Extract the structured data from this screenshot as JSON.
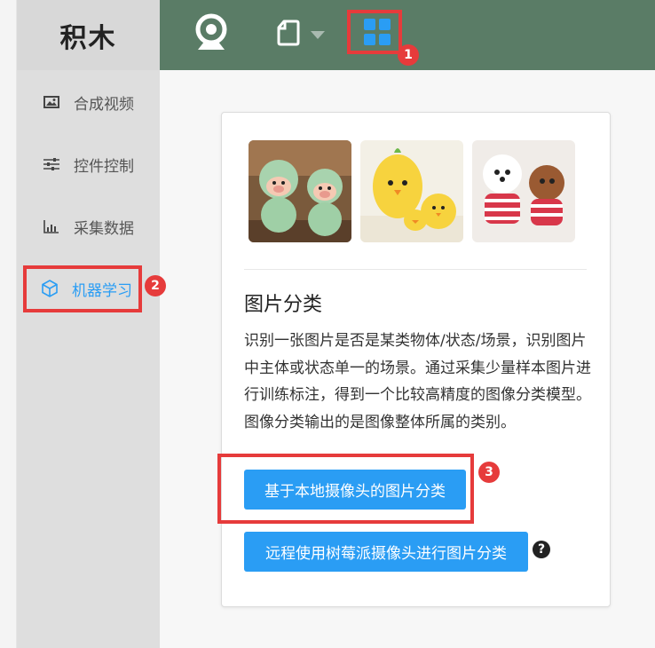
{
  "brand": {
    "title": "积木"
  },
  "topbar": {
    "icons": [
      "webcam-icon",
      "file-icon",
      "chevron-down-icon",
      "grid-icon"
    ]
  },
  "sidebar": {
    "items": [
      {
        "label": "合成视频",
        "icon": "image-icon"
      },
      {
        "label": "控件控制",
        "icon": "sliders-icon"
      },
      {
        "label": "采集数据",
        "icon": "chart-icon"
      },
      {
        "label": "机器学习",
        "icon": "cube-icon",
        "active": true
      }
    ]
  },
  "card": {
    "title": "图片分类",
    "description": "识别一张图片是否是某类物体/状态/场景，识别图片中主体或状态单一的场景。通过采集少量样本图片进行训练标注，得到一个比较高精度的图像分类模型。图像分类输出的是图像整体所属的类别。",
    "buttons": {
      "local": "基于本地摄像头的图片分类",
      "remote": "远程使用树莓派摄像头进行图片分类"
    },
    "help": "?"
  },
  "annotations": {
    "badge1": "1",
    "badge2": "2",
    "badge3": "3"
  },
  "colors": {
    "topbar": "#5a7c66",
    "accent": "#2a9df4",
    "annotation": "#e63b3b"
  }
}
